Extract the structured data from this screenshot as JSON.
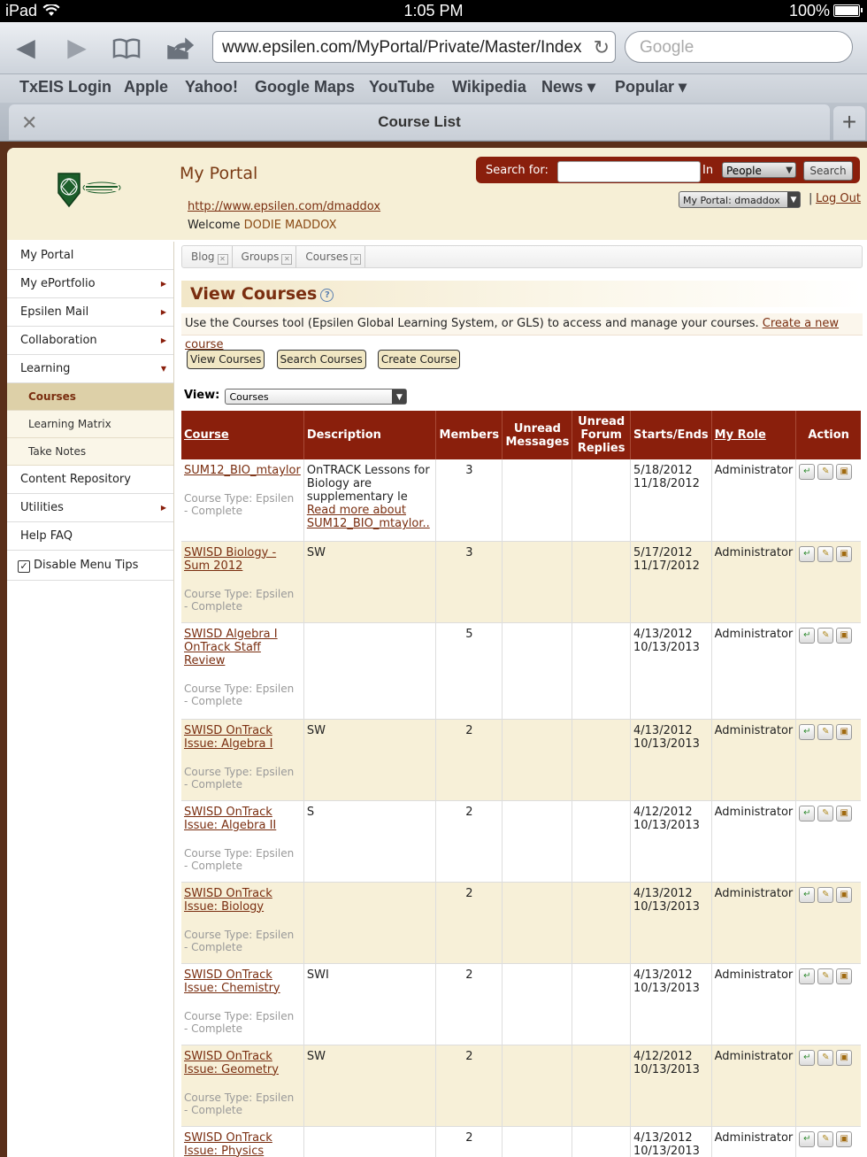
{
  "statusbar": {
    "device": "iPad",
    "time": "1:05 PM",
    "battery": "100%"
  },
  "browser": {
    "url": "www.epsilen.com/MyPortal/Private/Master/Index",
    "search_placeholder": "Google",
    "bookmarks": [
      "TxEIS Login",
      "Apple",
      "Yahoo!",
      "Google Maps",
      "YouTube",
      "Wikipedia",
      "News ▾",
      "Popular ▾"
    ],
    "tab_title": "Course List"
  },
  "header": {
    "title": "My Portal",
    "portal_link": "http://www.epsilen.com/dmaddox",
    "welcome_label": "Welcome",
    "user_name": "DODIE MADDOX",
    "search_label": "Search for:",
    "in_label": "In",
    "search_scope": "People",
    "search_button": "Search",
    "portal_select": "My Portal: dmaddox",
    "logout": "Log Out"
  },
  "sidebar": {
    "items": [
      {
        "label": "My Portal"
      },
      {
        "label": "My ePortfolio"
      },
      {
        "label": "Epsilen Mail"
      },
      {
        "label": "Collaboration"
      },
      {
        "label": "Learning"
      }
    ],
    "sub_items": [
      {
        "label": "Courses"
      },
      {
        "label": "Learning Matrix"
      },
      {
        "label": "Take Notes"
      }
    ],
    "items2": [
      {
        "label": "Content Repository"
      },
      {
        "label": "Utilities"
      },
      {
        "label": "Help FAQ"
      }
    ],
    "menu_tips": "Disable Menu Tips"
  },
  "main": {
    "subtabs": [
      "Blog",
      "Groups",
      "Courses"
    ],
    "page_title": "View Courses",
    "intro_text": "Use the Courses tool (Epsilen Global Learning System, or GLS) to access and manage your courses.",
    "intro_link": "Create a new course",
    "buttons": [
      "View Courses",
      "Search Courses",
      "Create Course"
    ],
    "view_label": "View:",
    "view_value": "Courses",
    "columns": [
      "Course",
      "Description",
      "Members",
      "Unread Messages",
      "Unread Forum Replies",
      "Starts/Ends",
      "My Role",
      "Action"
    ],
    "course_type": "Course Type: Epsilen - Complete",
    "rows": [
      {
        "course": "SUM12_BIO_mtaylor",
        "description": "OnTRACK Lessons for Biology are supplementary le",
        "read_more": "Read more about SUM12_BIO_mtaylor..",
        "members": "3",
        "start": "5/18/2012",
        "end": "11/18/2012",
        "role": "Administrator"
      },
      {
        "course": "SWISD Biology - Sum 2012",
        "description": "SW",
        "read_more": "",
        "members": "3",
        "start": "5/17/2012",
        "end": "11/17/2012",
        "role": "Administrator"
      },
      {
        "course": "SWISD Algebra I OnTrack Staff Review",
        "description": "",
        "read_more": "",
        "members": "5",
        "start": "4/13/2012",
        "end": "10/13/2013",
        "role": "Administrator"
      },
      {
        "course": "SWISD OnTrack Issue: Algebra I",
        "description": "SW",
        "read_more": "",
        "members": "2",
        "start": "4/13/2012",
        "end": "10/13/2013",
        "role": "Administrator"
      },
      {
        "course": "SWISD OnTrack Issue: Algebra II",
        "description": "S",
        "read_more": "",
        "members": "2",
        "start": "4/12/2012",
        "end": "10/13/2013",
        "role": "Administrator"
      },
      {
        "course": "SWISD OnTrack Issue: Biology",
        "description": "",
        "read_more": "",
        "members": "2",
        "start": "4/13/2012",
        "end": "10/13/2013",
        "role": "Administrator"
      },
      {
        "course": "SWISD OnTrack Issue: Chemistry",
        "description": "SWI",
        "read_more": "",
        "members": "2",
        "start": "4/13/2012",
        "end": "10/13/2013",
        "role": "Administrator"
      },
      {
        "course": "SWISD OnTrack Issue: Geometry",
        "description": "SW",
        "read_more": "",
        "members": "2",
        "start": "4/12/2012",
        "end": "10/13/2013",
        "role": "Administrator"
      },
      {
        "course": "SWISD OnTrack Issue: Physics",
        "description": "",
        "read_more": "",
        "members": "2",
        "start": "4/13/2012",
        "end": "10/13/2013",
        "role": "Administrator"
      }
    ]
  }
}
